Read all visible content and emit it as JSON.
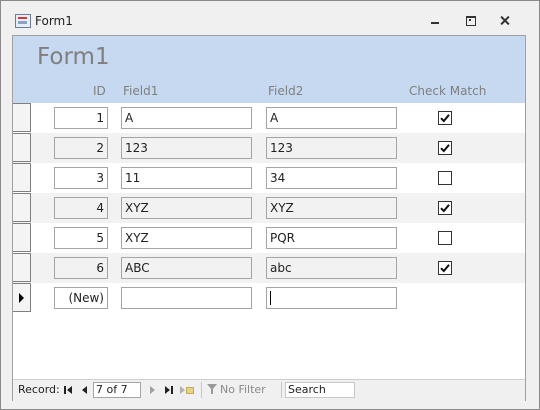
{
  "window": {
    "title": "Form1"
  },
  "form": {
    "title": "Form1",
    "columns": {
      "id": "ID",
      "field1": "Field1",
      "field2": "Field2",
      "check": "Check Match"
    }
  },
  "records": [
    {
      "id": "1",
      "field1": "A",
      "field2": "A",
      "check_match": true
    },
    {
      "id": "2",
      "field1": "123",
      "field2": "123",
      "check_match": true
    },
    {
      "id": "3",
      "field1": "11",
      "field2": "34",
      "check_match": false
    },
    {
      "id": "4",
      "field1": "XYZ",
      "field2": "XYZ",
      "check_match": true
    },
    {
      "id": "5",
      "field1": "XYZ",
      "field2": "PQR",
      "check_match": false
    },
    {
      "id": "6",
      "field1": "ABC",
      "field2": "abc",
      "check_match": true
    }
  ],
  "new_record": {
    "id": "(New)",
    "field1": "",
    "field2": ""
  },
  "navbar": {
    "record_label": "Record:",
    "position": "7 of 7",
    "filter_label": "No Filter",
    "search_value": "Search"
  }
}
